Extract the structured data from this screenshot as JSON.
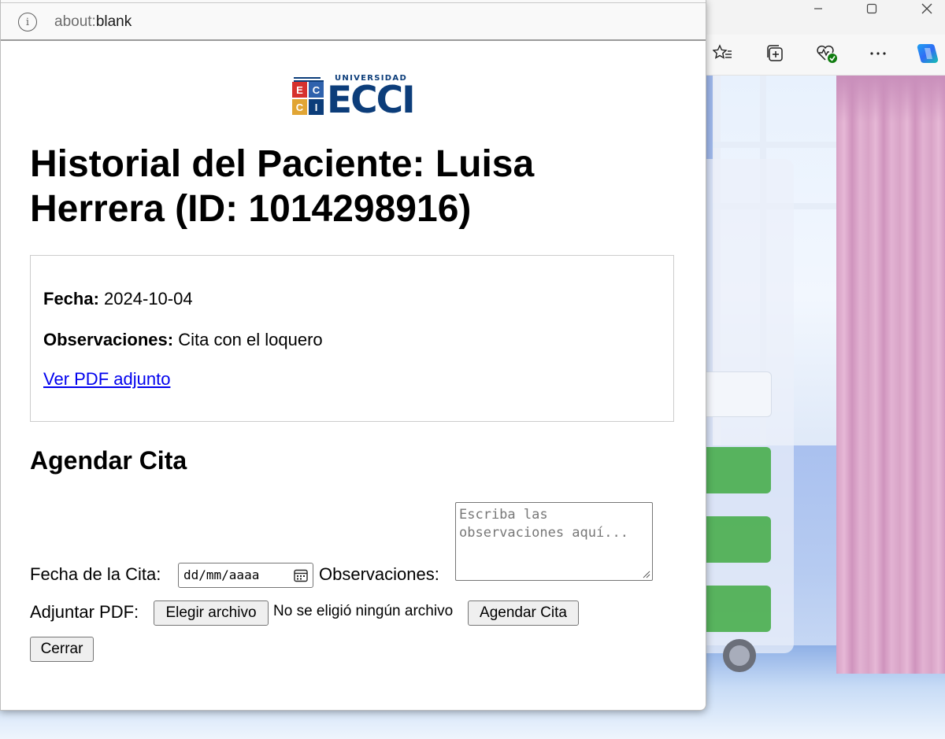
{
  "browser": {
    "url_scheme": "about:",
    "url_rest": "blank",
    "window_controls": [
      "minimize-icon",
      "maximize-icon",
      "close-icon"
    ],
    "toolbar_icons": [
      "favorites-icon",
      "collections-icon",
      "browser-essentials-icon",
      "more-icon",
      "copilot-icon"
    ]
  },
  "logo": {
    "top_text": "UNIVERSIDAD",
    "word": "ECCI",
    "cells": [
      "E",
      "C",
      "C",
      "I"
    ],
    "colors": {
      "navy": "#0c3d7a",
      "red": "#d6322e",
      "blue": "#2f62ad",
      "gold": "#e1a534"
    }
  },
  "page": {
    "title": "Historial del Paciente: Luisa Herrera (ID: 1014298916)"
  },
  "record": {
    "fecha_label": "Fecha:",
    "fecha_value": "2024-10-04",
    "obs_label": "Observaciones:",
    "obs_value": "Cita con el loquero",
    "pdf_link": "Ver PDF adjunto"
  },
  "form": {
    "section_title": "Agendar Cita",
    "date_label": "Fecha de la Cita:",
    "date_placeholder": "dd/mm/aaaa",
    "obs_label": "Observaciones:",
    "obs_placeholder": "Escriba las observaciones aquí...",
    "pdf_label": "Adjuntar PDF:",
    "choose_file_button": "Elegir archivo",
    "no_file_text": "No se eligió ningún archivo",
    "submit_button": "Agendar Cita",
    "close_button": "Cerrar"
  },
  "colors": {
    "link": "#0000ee",
    "bg_button_green": "#4caf50"
  }
}
